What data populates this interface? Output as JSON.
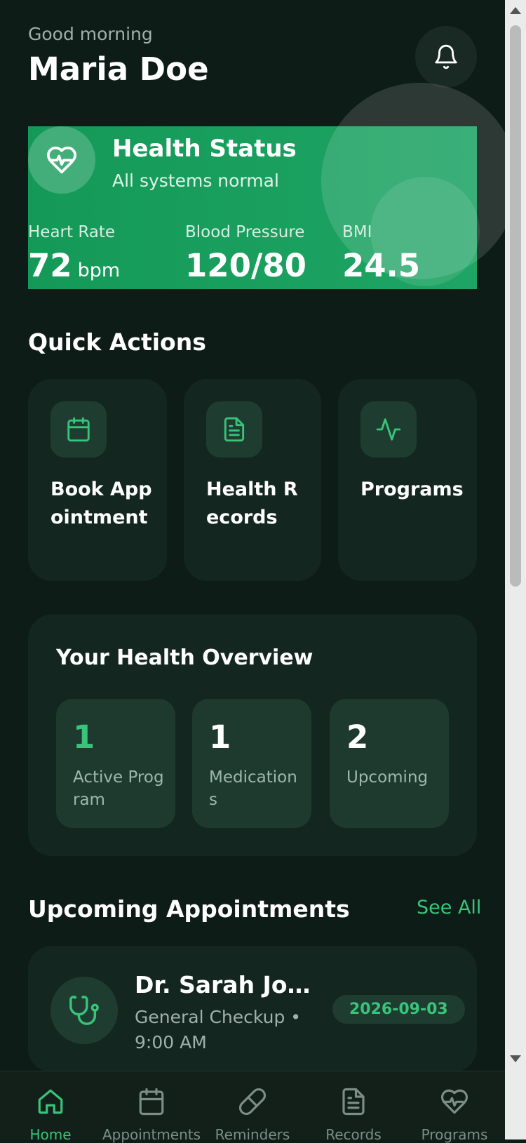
{
  "header": {
    "greeting": "Good morning",
    "user_name": "Maria Doe",
    "notification_icon": "bell-icon"
  },
  "health_status": {
    "title": "Health Status",
    "subtitle": "All systems normal",
    "icon": "heart-pulse-icon",
    "metrics": [
      {
        "label": "Heart Rate",
        "value": "72",
        "unit": "bpm"
      },
      {
        "label": "Blood Pressure",
        "value": "120/80",
        "unit": ""
      },
      {
        "label": "BMI",
        "value": "24.5",
        "unit": ""
      }
    ]
  },
  "quick_actions": {
    "title": "Quick Actions",
    "items": [
      {
        "label": "Book Appointment",
        "icon": "calendar-icon"
      },
      {
        "label": "Health Records",
        "icon": "document-icon"
      },
      {
        "label": "Programs",
        "icon": "activity-icon"
      }
    ]
  },
  "overview": {
    "title": "Your Health Overview",
    "stats": [
      {
        "value": "1",
        "label": "Active Program",
        "accent": true
      },
      {
        "value": "1",
        "label": "Medications",
        "accent": false
      },
      {
        "value": "2",
        "label": "Upcoming",
        "accent": false
      }
    ]
  },
  "appointments": {
    "title": "Upcoming Appointments",
    "see_all": "See All",
    "items": [
      {
        "doctor": "Dr. Sarah Johnson",
        "type": "General Checkup",
        "separator": "•",
        "time": "9:00 AM",
        "date": "2026-09-03",
        "icon": "stethoscope-icon"
      }
    ]
  },
  "bottom_nav": {
    "items": [
      {
        "label": "Home",
        "icon": "home-icon",
        "active": true
      },
      {
        "label": "Appointments",
        "icon": "calendar-icon",
        "active": false
      },
      {
        "label": "Reminders",
        "icon": "pill-icon",
        "active": false
      },
      {
        "label": "Records",
        "icon": "document-icon",
        "active": false
      },
      {
        "label": "Programs",
        "icon": "heart-pulse-icon",
        "active": false
      }
    ]
  },
  "colors": {
    "background": "#0e1c17",
    "card": "#142620",
    "accent_green": "#38c47a",
    "status_card_green": "#149958",
    "muted_text": "#9fb1aa"
  }
}
